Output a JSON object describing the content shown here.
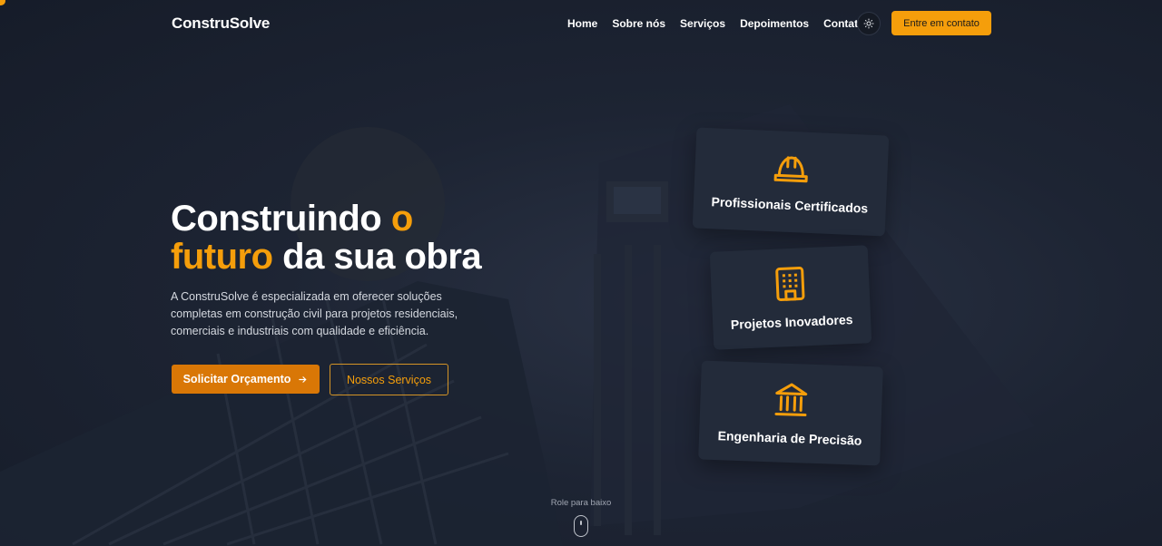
{
  "nav": {
    "logo": "ConstruSolve",
    "links": [
      "Home",
      "Sobre nós",
      "Serviços",
      "Depoimentos",
      "Contato"
    ],
    "theme_toggle_icon": "sun-icon",
    "cta_label": "Entre em contato"
  },
  "hero": {
    "title_part1": "Construindo",
    "title_accent1": "o",
    "title_accent2": "futuro",
    "title_part2": "da sua obra",
    "description": "A ConstruSolve é especializada em oferecer soluções completas em construção civil para projetos residenciais, comerciais e industriais com qualidade e eficiência.",
    "primary_button": "Solicitar Orçamento",
    "primary_button_icon": "arrow-right-icon",
    "secondary_button": "Nossos Serviços"
  },
  "cards": [
    {
      "label": "Profissionais Certificados",
      "icon": "hard-hat-icon"
    },
    {
      "label": "Projetos Inovadores",
      "icon": "building-icon"
    },
    {
      "label": "Engenharia de Precisão",
      "icon": "landmark-icon"
    }
  ],
  "scroll_hint": {
    "text": "Role para baixo",
    "icon": "mouse-icon"
  },
  "colors": {
    "accent": "#f59e0b",
    "accent_dark": "#d97706",
    "background": "#1a2030",
    "card": "#232b3a"
  }
}
